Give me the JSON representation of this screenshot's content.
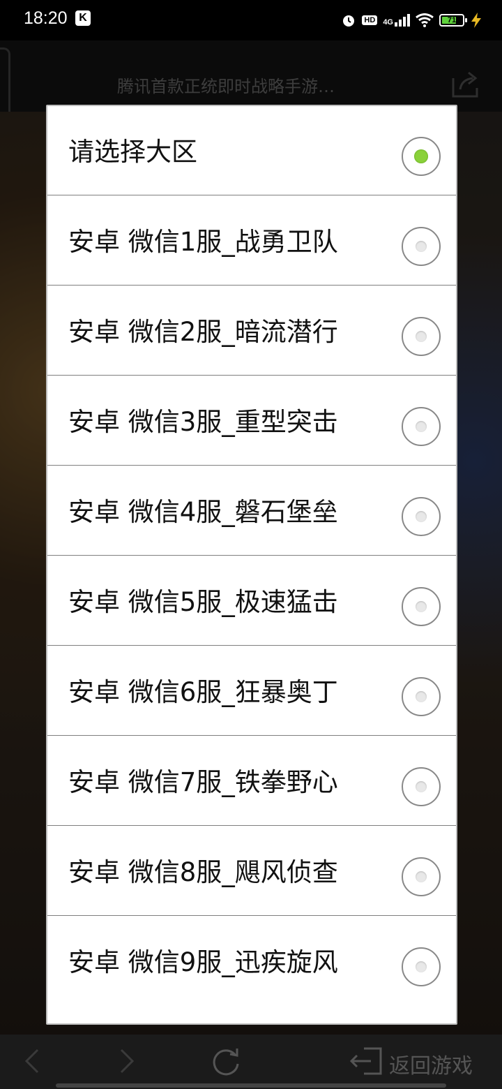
{
  "status_bar": {
    "time": "18:20",
    "app_badge": "K",
    "hd_label": "HD",
    "network": "4G",
    "battery_percent": "71",
    "battery_level": 0.71
  },
  "page": {
    "title": "腾讯首款正统即时战略手游…"
  },
  "dialog": {
    "options": [
      {
        "label": "请选择大区",
        "selected": true
      },
      {
        "label": "安卓 微信1服_战勇卫队",
        "selected": false
      },
      {
        "label": "安卓 微信2服_暗流潜行",
        "selected": false
      },
      {
        "label": "安卓 微信3服_重型突击",
        "selected": false
      },
      {
        "label": "安卓 微信4服_磐石堡垒",
        "selected": false
      },
      {
        "label": "安卓 微信5服_极速猛击",
        "selected": false
      },
      {
        "label": "安卓 微信6服_狂暴奥丁",
        "selected": false
      },
      {
        "label": "安卓 微信7服_铁拳野心",
        "selected": false
      },
      {
        "label": "安卓 微信8服_飓风侦查",
        "selected": false
      },
      {
        "label": "安卓 微信9服_迅疾旋风",
        "selected": false
      }
    ]
  },
  "toolbar": {
    "back_to_game_label": "返回游戏"
  },
  "colors": {
    "selected_radio": "#8ad13a",
    "battery_fill": "#5ed13b"
  }
}
